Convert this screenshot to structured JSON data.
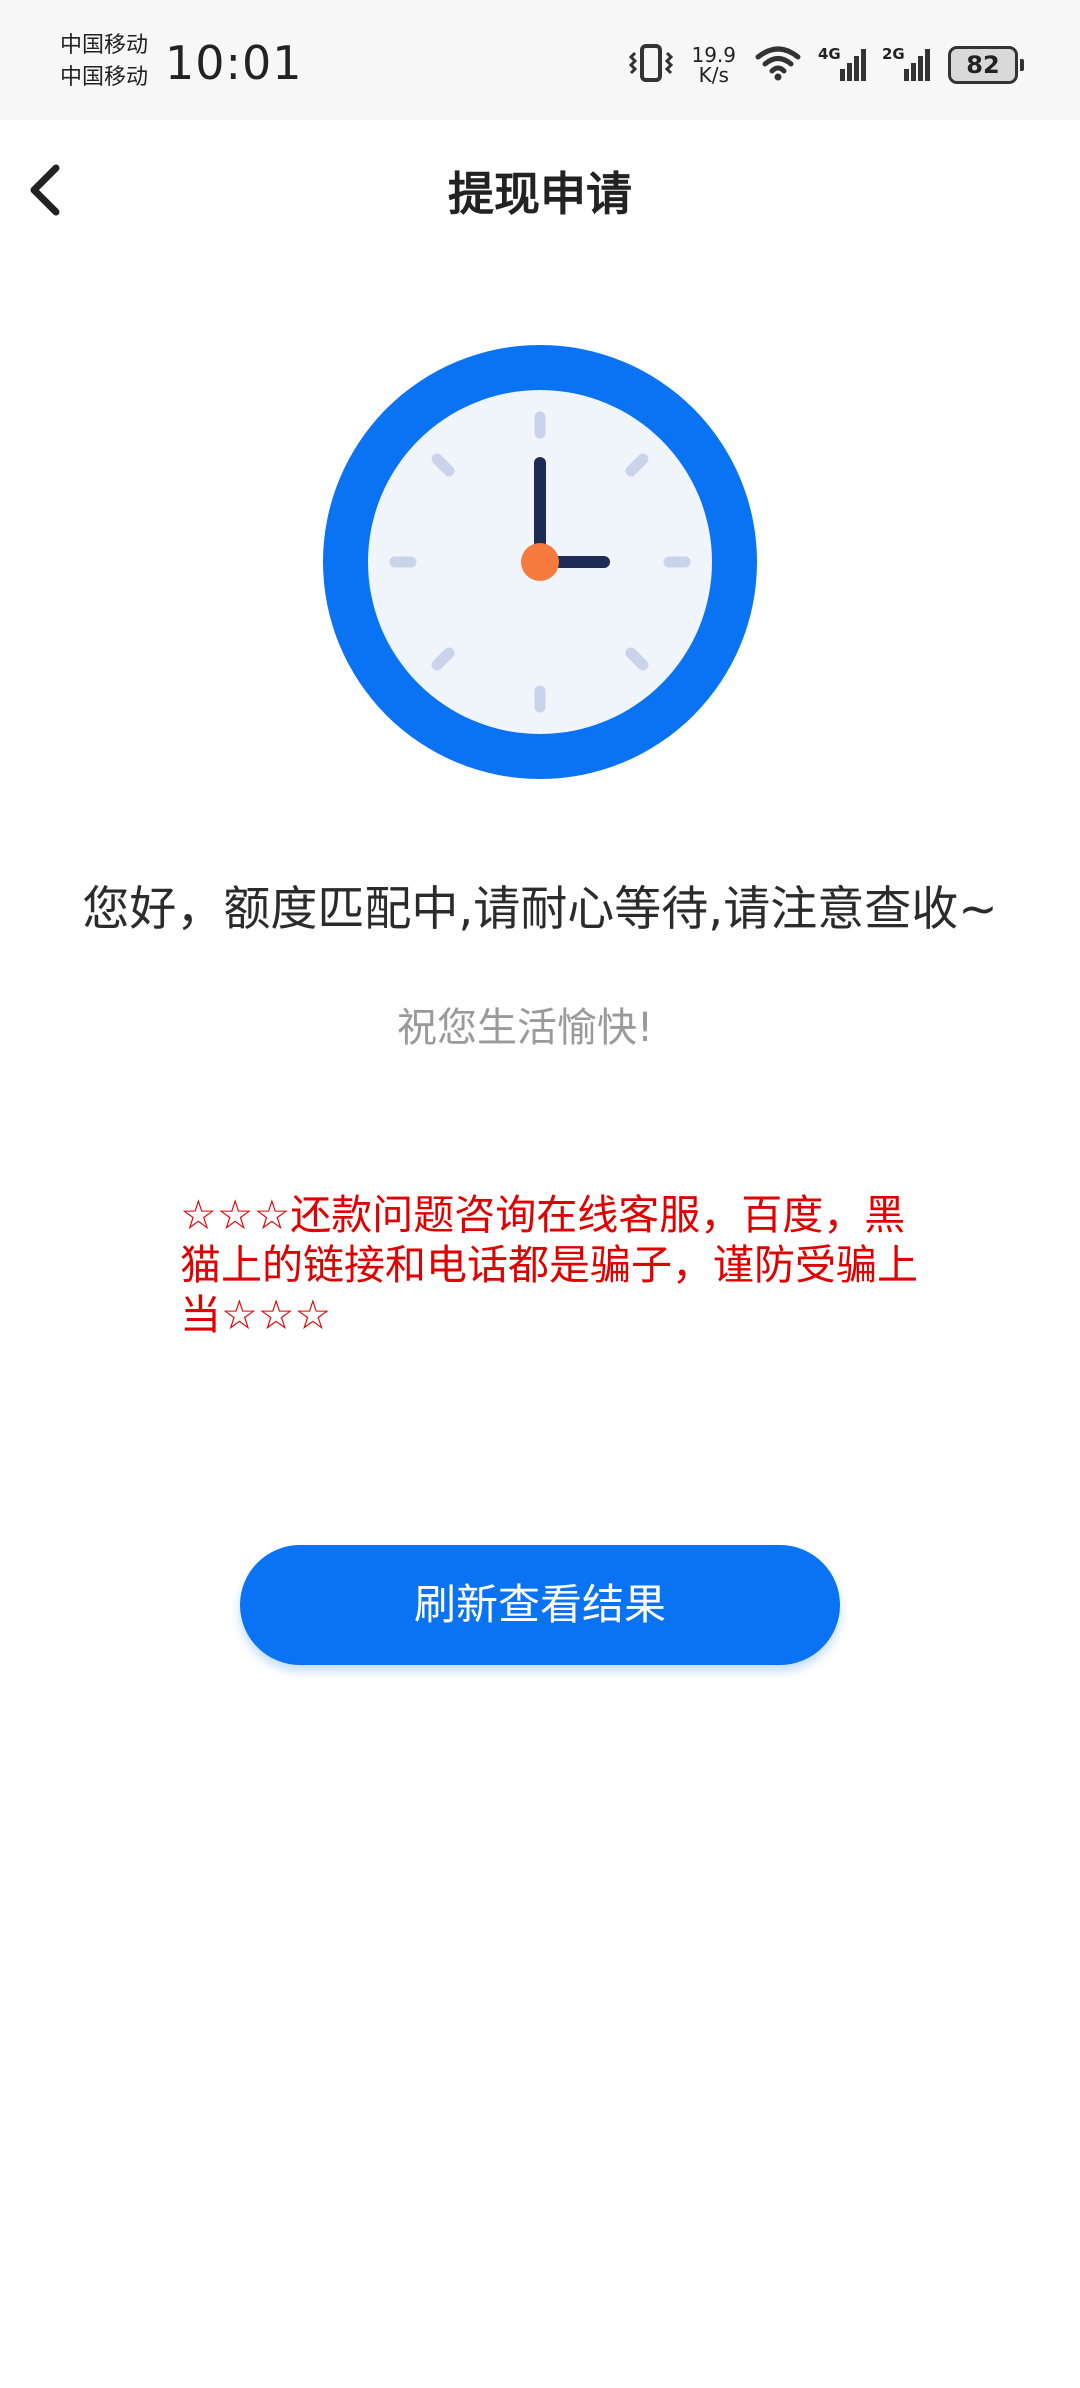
{
  "status_bar": {
    "carrier_1": "中国移动",
    "carrier_2": "中国移动",
    "time": "10:01",
    "net_speed_value": "19.9",
    "net_speed_unit": "K/s",
    "signal_1_tag": "4G",
    "signal_2_tag": "2G",
    "battery_level": "82",
    "icons": [
      "vibrate-icon",
      "wifi-icon",
      "signal-4g-icon",
      "signal-2g-icon",
      "battery-icon"
    ]
  },
  "header": {
    "back_icon": "chevron-left-icon",
    "title": "提现申请"
  },
  "main": {
    "illustration": "clock-icon",
    "message": "您好，额度匹配中,请耐心等待,请注意查收~",
    "wish": "祝您生活愉快!",
    "warning": "☆☆☆还款问题咨询在线客服，百度，黑猫上的链接和电话都是骗子，谨防受骗上当☆☆☆",
    "refresh_button_label": "刷新查看结果"
  },
  "colors": {
    "primary": "#0a73f4",
    "warning": "#e00000",
    "clock_face": "#f0f5fb",
    "clock_center": "#f77a3e",
    "clock_hands": "#1e2b55"
  }
}
